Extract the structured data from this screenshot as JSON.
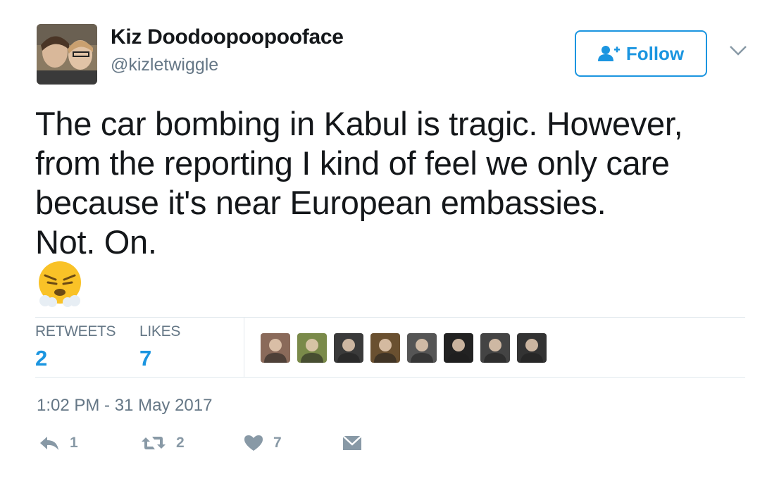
{
  "user": {
    "display_name": "Kiz Doodoopoopooface",
    "handle": "@kizletwiggle"
  },
  "follow_button": {
    "label": "Follow"
  },
  "tweet": {
    "text": "The car bombing in Kabul is tragic. However,\nfrom the reporting I kind of feel we only care\nbecause it's near European embassies.\nNot. On.",
    "emoji_icon": "angry-face-steam-icon"
  },
  "stats": {
    "retweets_label": "RETWEETS",
    "retweets_count": "2",
    "likes_label": "LIKES",
    "likes_count": "7"
  },
  "likers": [
    {
      "name": "liker-avatar-1",
      "color": "#8a6a5a"
    },
    {
      "name": "liker-avatar-2",
      "color": "#7a8a4a"
    },
    {
      "name": "liker-avatar-3",
      "color": "#3a3a3a"
    },
    {
      "name": "liker-avatar-4",
      "color": "#6a5030"
    },
    {
      "name": "liker-avatar-5",
      "color": "#555555"
    },
    {
      "name": "liker-avatar-6",
      "color": "#222222"
    },
    {
      "name": "liker-avatar-7",
      "color": "#444444"
    },
    {
      "name": "liker-avatar-8",
      "color": "#333333"
    }
  ],
  "timestamp": "1:02 PM - 31 May 2017",
  "actions": {
    "reply_count": "1",
    "retweet_count": "2",
    "like_count": "7"
  },
  "colors": {
    "accent": "#1b95e0",
    "muted": "#657786",
    "icon_gray": "#8899a6"
  }
}
